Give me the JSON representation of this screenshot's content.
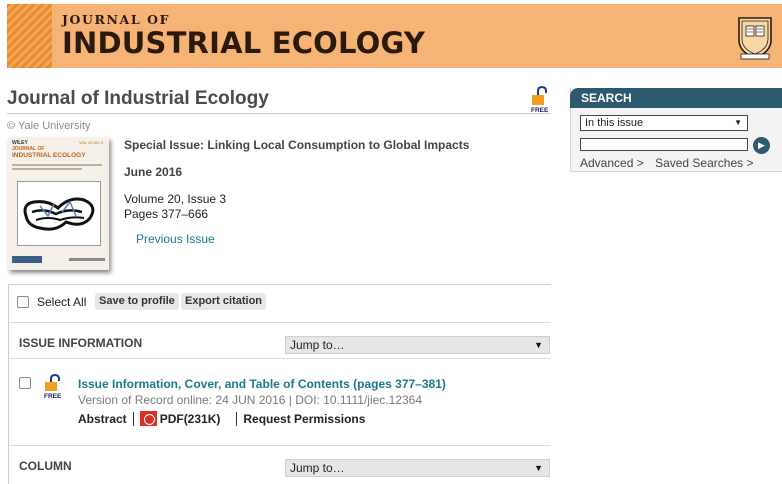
{
  "banner": {
    "supertitle": "JOURNAL OF",
    "title": "INDUSTRIAL ECOLOGY",
    "seal_text": "LUX ET VERITAS"
  },
  "journal": {
    "title": "Journal of Industrial Ecology",
    "copyright": "© Yale University",
    "free_label": "FREE"
  },
  "cover": {
    "publisher": "WILEY",
    "volume": "VOL 20 NO 3",
    "line1": "JOURNAL OF",
    "line2": "INDUSTRIAL ECOLOGY"
  },
  "issue": {
    "special": "Special Issue: Linking Local Consumption to Global Impacts",
    "date": "June 2016",
    "volume": "Volume 20, Issue 3",
    "pages": "Pages 377–666",
    "previous": "Previous Issue"
  },
  "toolbar": {
    "select_all": "Select All",
    "save_to_profile": "Save to profile",
    "export_citation": "Export citation"
  },
  "sections": [
    {
      "title": "ISSUE INFORMATION",
      "jump": "Jump to…"
    },
    {
      "title": "COLUMN",
      "jump": "Jump to…"
    }
  ],
  "article": {
    "title": "Issue Information, Cover, and Table of Contents (pages 377–381)",
    "meta": "Version of Record online: 24 JUN 2016 | DOI: 10.1111/jiec.12364",
    "abstract": "Abstract",
    "pdf": "PDF(231K)",
    "permissions": "Request Permissions",
    "free_label": "FREE"
  },
  "search": {
    "heading": "SEARCH",
    "scope": "In this issue",
    "advanced": "Advanced >",
    "saved": "Saved Searches >"
  },
  "colors": {
    "banner_bg": "#f5b475",
    "link": "#1b7a8a",
    "search_header": "#2d5a6e"
  }
}
